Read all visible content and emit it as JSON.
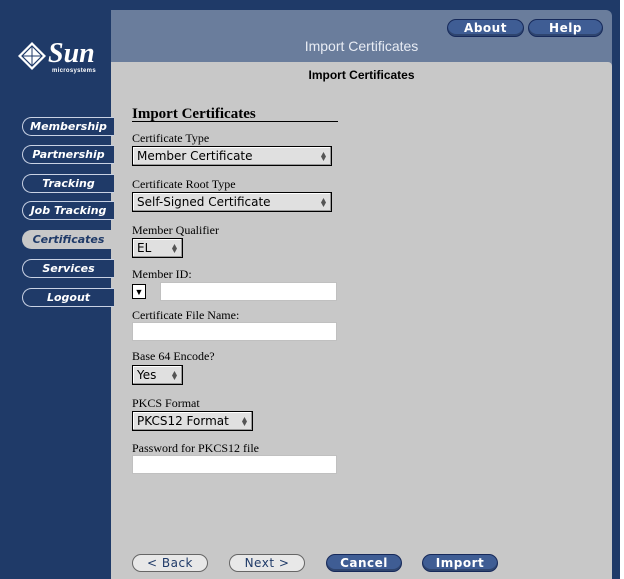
{
  "header": {
    "title": "Import Certificates",
    "about_label": "About",
    "help_label": "Help"
  },
  "logo": {
    "word": "Sun",
    "sub": "microsystems"
  },
  "content": {
    "title": "Import Certificates"
  },
  "sidebar": {
    "items": [
      {
        "label": "Membership"
      },
      {
        "label": "Partnership"
      },
      {
        "label": "Tracking"
      },
      {
        "label": "Job Tracking"
      },
      {
        "label": "Certificates",
        "active": true
      },
      {
        "label": "Services"
      },
      {
        "label": "Logout"
      }
    ]
  },
  "form": {
    "section_title": "Import Certificates",
    "certificate_type": {
      "label": "Certificate Type",
      "value": "Member Certificate"
    },
    "certificate_root_type": {
      "label": "Certificate Root Type",
      "value": "Self-Signed Certificate"
    },
    "member_qualifier": {
      "label": "Member Qualifier",
      "value": "EL"
    },
    "member_id": {
      "label": "Member ID:",
      "value": ""
    },
    "certificate_file_name": {
      "label": "Certificate File Name:",
      "value": ""
    },
    "base64_encode": {
      "label": "Base 64 Encode?",
      "value": "Yes"
    },
    "pkcs_format": {
      "label": "PKCS Format",
      "value": "PKCS12 Format"
    },
    "pkcs12_password": {
      "label": "Password for PKCS12 file",
      "value": ""
    }
  },
  "footer": {
    "back_label": "< Back",
    "next_label": "Next >",
    "cancel_label": "Cancel",
    "import_label": "Import"
  },
  "colors": {
    "frame": "#1f3a68",
    "topbar": "#6a7d9c",
    "panel": "#c8c8c8",
    "pill_dark": "#3f5d94"
  }
}
